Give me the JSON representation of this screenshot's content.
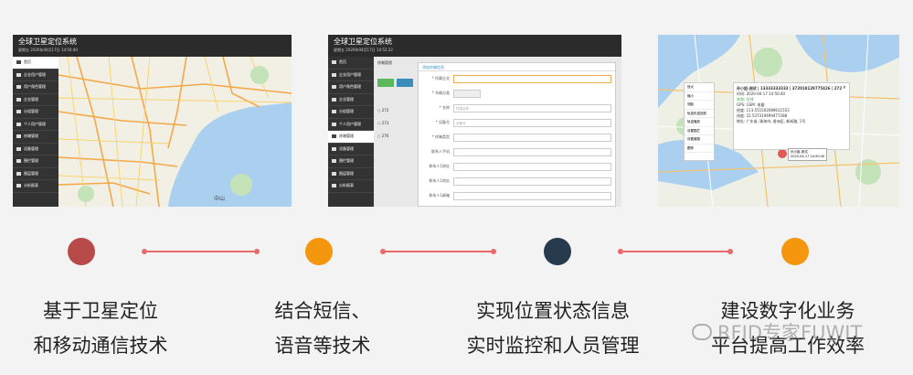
{
  "panel1": {
    "title": "全球卫星定位系统",
    "date": "星期五 2020年04月17日 14:50:40",
    "menu": [
      "首页",
      "企业用户管理",
      "用户角色管理",
      "企业管理",
      "分组管理",
      "个人用户管理",
      "终端管理",
      "设备管理",
      "围栏管理",
      "图层管理",
      "分析报表"
    ],
    "map_label": "中山"
  },
  "panel2": {
    "title": "全球卫星定位系统",
    "date": "星期五 2020年04月17日 14:52:22",
    "menu": [
      "首页",
      "企业用户管理",
      "用户角色管理",
      "企业管理",
      "分组管理",
      "个人用户管理",
      "终端管理",
      "设备管理",
      "围栏管理",
      "图层管理",
      "分析报表"
    ],
    "tab": "终端管理",
    "modal_title": "添加终端信息",
    "rows": [
      "272",
      "273",
      "276"
    ],
    "fields": [
      {
        "label": "* 所属企业",
        "placeholder": ""
      },
      {
        "label": "* 车辆分类",
        "placeholder": ""
      },
      {
        "label": "* 名称",
        "placeholder": "终端名称"
      },
      {
        "label": "* 设备号",
        "placeholder": "设备号"
      },
      {
        "label": "* 终端类型",
        "placeholder": ""
      },
      {
        "label": "联系人手机",
        "placeholder": ""
      },
      {
        "label": "联系人1地址",
        "placeholder": ""
      },
      {
        "label": "联系人1地址",
        "placeholder": ""
      },
      {
        "label": "联系人1邮箱",
        "placeholder": ""
      }
    ]
  },
  "panel3": {
    "popup_lines": [
      "孙小姐-测试 | 13333333333 | 372018129775426 | 272",
      "时间: 2020-04-17 14:50:40",
      "状态: 在线",
      "GPS: GSM: 电量:",
      "经度: 113.551502089611553",
      "纬度: 22.537319499477288",
      "地址: 广东省, 珠海市, 香洲区, 新街路, 1号"
    ],
    "ctx_menu": [
      "放大",
      "缩小",
      "测距",
      "轨迹形迹回放",
      "轨迹播放",
      "设置围栏",
      "设置道路",
      "跟踪"
    ],
    "marker_label": "孙小姐-测试",
    "marker_time": "2020-04-17 14:50:40"
  },
  "colors": {
    "red": "#b94a4a",
    "orange": "#f5960f",
    "navy": "#283a4d",
    "line": "#e96a6a"
  },
  "captions": [
    {
      "line1": "基于卫星定位",
      "line2": "和移动通信技术"
    },
    {
      "line1": "结合短信、",
      "line2": "语音等技术"
    },
    {
      "line1": "实现位置状态信息",
      "line2": "实时监控和人员管理"
    },
    {
      "line1": "建设数字化业务",
      "line2": "平台提高工作效率"
    }
  ],
  "watermark": "RFID专家FUWIT"
}
